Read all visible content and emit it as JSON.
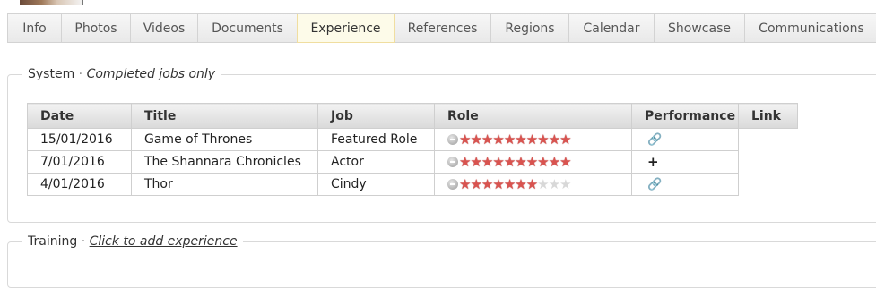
{
  "tabs": [
    {
      "label": "Info",
      "width": 61
    },
    {
      "label": "Photos",
      "width": 78
    },
    {
      "label": "Videos",
      "width": 76
    },
    {
      "label": "Documents",
      "width": 112
    },
    {
      "label": "Experience",
      "width": 109,
      "active": true
    },
    {
      "label": "References",
      "width": 109
    },
    {
      "label": "Regions",
      "width": 88
    },
    {
      "label": "Calendar",
      "width": 96
    },
    {
      "label": "Showcase",
      "width": 102
    },
    {
      "label": "Communications",
      "width": 150
    }
  ],
  "system": {
    "legend_title": "System",
    "separator": "·",
    "legend_note": "Completed jobs only",
    "columns": [
      "Date",
      "Title",
      "Job",
      "Role",
      "Performance",
      "Link"
    ],
    "rows": [
      {
        "date": "15/01/2016",
        "title": "Game of Thrones",
        "job": "Featured Role",
        "role_rating": 10,
        "role_max": 10,
        "performance_icon": "link-icon",
        "performance_glyph": "🔗"
      },
      {
        "date": "7/01/2016",
        "title": "The Shannara Chronicles",
        "job": "Actor",
        "role_rating": 10,
        "role_max": 10,
        "performance_icon": "plus-icon",
        "performance_glyph": "+"
      },
      {
        "date": "4/01/2016",
        "title": "Thor",
        "job": "Cindy",
        "role_rating": 7,
        "role_max": 10,
        "performance_icon": "link-icon",
        "performance_glyph": "🔗"
      }
    ]
  },
  "training": {
    "legend_title": "Training",
    "separator": "·",
    "legend_link": "Click to add experience"
  },
  "colors": {
    "star_on": "#d9534f",
    "star_off": "#d8d8d8",
    "active_tab_bg": "#fdfbe9"
  }
}
